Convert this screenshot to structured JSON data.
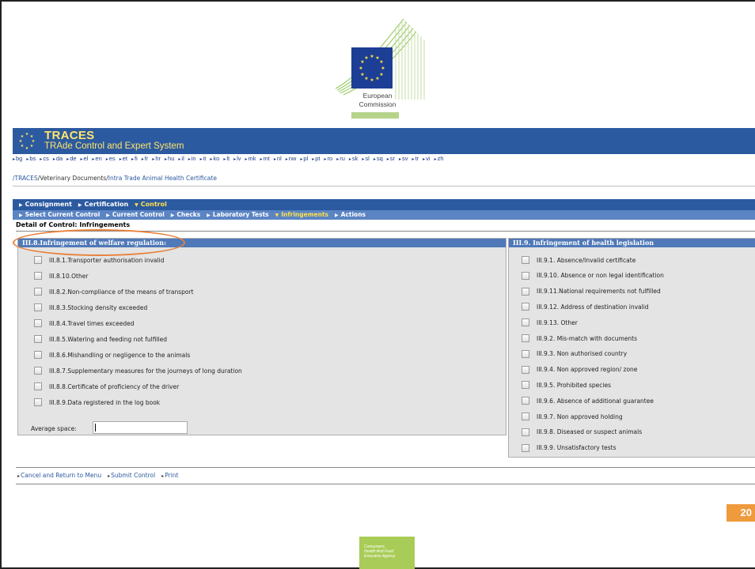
{
  "logo": {
    "line1": "European",
    "line2": "Commission"
  },
  "traces": {
    "title": "TRACES",
    "subtitle": "TRAde Control and Expert System"
  },
  "languages": [
    "bg",
    "bs",
    "cs",
    "da",
    "de",
    "el",
    "en",
    "es",
    "et",
    "fi",
    "fr",
    "hr",
    "hu",
    "il",
    "in",
    "it",
    "ko",
    "lt",
    "lv",
    "mk",
    "mt",
    "nl",
    "nw",
    "pl",
    "pt",
    "ro",
    "ru",
    "sk",
    "sl",
    "sq",
    "sr",
    "sv",
    "tr",
    "vi",
    "zh"
  ],
  "breadcrumb": {
    "root": "/TRACES",
    "sep1": "/",
    "vet": "Veterinary Documents",
    "sep2": "/",
    "cert": "Intra Trade Animal Health Certificate"
  },
  "nav_primary": [
    {
      "label": "Consignment",
      "active": false
    },
    {
      "label": "Certification",
      "active": false
    },
    {
      "label": "Control",
      "active": true
    }
  ],
  "nav_secondary": [
    {
      "label": "Select Current Control",
      "active": false
    },
    {
      "label": "Current Control",
      "active": false
    },
    {
      "label": "Checks",
      "active": false
    },
    {
      "label": "Laboratory Tests",
      "active": false
    },
    {
      "label": "Infringements",
      "active": true
    },
    {
      "label": "Actions",
      "active": false
    }
  ],
  "detail_title": "Detail of Control: Infringements",
  "welfare": {
    "header": "III.8.Infringement of welfare regulation:",
    "items": [
      "III.8.1.Transporter authorisation invalid",
      "III.8.10.Other",
      "III.8.2.Non-compliance of the means of transport",
      "III.8.3.Stocking density exceeded",
      "III.8.4.Travel times exceeded",
      "III.8.5.Watering and feeding not fulfilled",
      "III.8.6.Mishandling or negligence to the animals",
      "III.8.7.Supplementary measures for the journeys of long duration",
      "III.8.8.Certificate of proficiency of the driver",
      "III.8.9.Data registered in the log book"
    ],
    "avg_label": "Average space:",
    "avg_value": ""
  },
  "health": {
    "header": "III.9. Infringement of health legislation",
    "items": [
      "III.9.1. Absence/Invalid certificate",
      "III.9.10. Absence or non legal identification",
      "III.9.11.National requirements not fulfilled",
      "III.9.12. Address of destination invalid",
      "III.9.13. Other",
      "III.9.2. Mis-match with documents",
      "III.9.3. Non authorised country",
      "III.9.4. Non approved region/ zone",
      "III.9.5. Prohibited species",
      "III.9.6. Absence of additional guarantee",
      "III.9.7. Non approved holding",
      "III.9.8. Diseased or suspect animals",
      "III.9.9. Unsatisfactory tests"
    ]
  },
  "actions": [
    "Cancel and Return to Menu",
    "Submit Control",
    "Print"
  ],
  "page_number": "20",
  "agency": [
    "Consumers,",
    "Health And Food",
    "Executive Agency"
  ],
  "colors": {
    "header_blue": "#2c5aa0",
    "accent_yellow": "#ffe56b",
    "highlight_orange": "#e8823a",
    "page_badge": "#ef9a3c",
    "agency_green": "#a8cc57"
  }
}
